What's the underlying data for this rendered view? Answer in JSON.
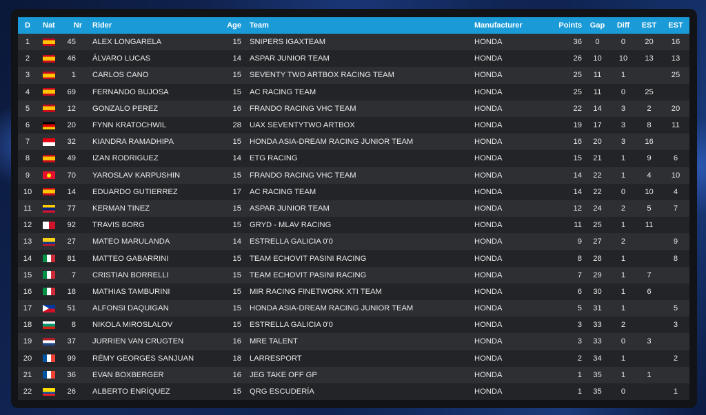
{
  "columns": [
    "D",
    "Nat",
    "Nr",
    "Rider",
    "Age",
    "Team",
    "Manufacturer",
    "Points",
    "Gap",
    "Diff",
    "EST",
    "EST"
  ],
  "rows": [
    {
      "pos": "1",
      "flag": "es",
      "nr": "45",
      "rider": "Alex Longarela",
      "age": "15",
      "team": "Snipers IGAXTeam",
      "manufacturer": "Honda",
      "points": "36",
      "gap": "0",
      "diff": "0",
      "est1": "20",
      "est2": "16"
    },
    {
      "pos": "2",
      "flag": "es",
      "nr": "46",
      "rider": "Álvaro Lucas",
      "age": "14",
      "team": "Aspar Junior Team",
      "manufacturer": "Honda",
      "points": "26",
      "gap": "10",
      "diff": "10",
      "est1": "13",
      "est2": "13"
    },
    {
      "pos": "3",
      "flag": "es",
      "nr": "1",
      "rider": "Carlos Cano",
      "age": "15",
      "team": "Seventy Two Artbox Racing Team",
      "manufacturer": "Honda",
      "points": "25",
      "gap": "11",
      "diff": "1",
      "est1": "",
      "est2": "25"
    },
    {
      "pos": "4",
      "flag": "es",
      "nr": "69",
      "rider": "Fernando Bujosa",
      "age": "15",
      "team": "AC Racing Team",
      "manufacturer": "Honda",
      "points": "25",
      "gap": "11",
      "diff": "0",
      "est1": "25",
      "est2": ""
    },
    {
      "pos": "5",
      "flag": "es",
      "nr": "12",
      "rider": "Gonzalo Perez",
      "age": "16",
      "team": "Frando Racing VHC Team",
      "manufacturer": "Honda",
      "points": "22",
      "gap": "14",
      "diff": "3",
      "est1": "2",
      "est2": "20"
    },
    {
      "pos": "6",
      "flag": "de",
      "nr": "20",
      "rider": "Fynn Kratochwil",
      "age": "28",
      "team": "UAX SeventyTwo Artbox",
      "manufacturer": "Honda",
      "points": "19",
      "gap": "17",
      "diff": "3",
      "est1": "8",
      "est2": "11"
    },
    {
      "pos": "7",
      "flag": "id",
      "nr": "32",
      "rider": "Kiandra Ramadhipa",
      "age": "15",
      "team": "Honda Asia-Dream Racing Junior Team",
      "manufacturer": "Honda",
      "points": "16",
      "gap": "20",
      "diff": "3",
      "est1": "16",
      "est2": ""
    },
    {
      "pos": "8",
      "flag": "es",
      "nr": "49",
      "rider": "Izan Rodriguez",
      "age": "14",
      "team": "ETG Racing",
      "manufacturer": "Honda",
      "points": "15",
      "gap": "21",
      "diff": "1",
      "est1": "9",
      "est2": "6"
    },
    {
      "pos": "9",
      "flag": "kg",
      "nr": "70",
      "rider": "Yaroslav Karpushin",
      "age": "15",
      "team": "Frando Racing VHC Team",
      "manufacturer": "Honda",
      "points": "14",
      "gap": "22",
      "diff": "1",
      "est1": "4",
      "est2": "10"
    },
    {
      "pos": "10",
      "flag": "es",
      "nr": "14",
      "rider": "Eduardo Gutierrez",
      "age": "17",
      "team": "AC Racing Team",
      "manufacturer": "Honda",
      "points": "14",
      "gap": "22",
      "diff": "0",
      "est1": "10",
      "est2": "4"
    },
    {
      "pos": "11",
      "flag": "ve",
      "nr": "77",
      "rider": "Kerman Tinez",
      "age": "15",
      "team": "Aspar Junior Team",
      "manufacturer": "Honda",
      "points": "12",
      "gap": "24",
      "diff": "2",
      "est1": "5",
      "est2": "7"
    },
    {
      "pos": "12",
      "flag": "mt",
      "nr": "92",
      "rider": "Travis Borg",
      "age": "15",
      "team": "GRYD - MLAV Racing",
      "manufacturer": "Honda",
      "points": "11",
      "gap": "25",
      "diff": "1",
      "est1": "11",
      "est2": ""
    },
    {
      "pos": "13",
      "flag": "co",
      "nr": "27",
      "rider": "Mateo Marulanda",
      "age": "14",
      "team": "Estrella Galicia 0'0",
      "manufacturer": "Honda",
      "points": "9",
      "gap": "27",
      "diff": "2",
      "est1": "",
      "est2": "9"
    },
    {
      "pos": "14",
      "flag": "it",
      "nr": "81",
      "rider": "Matteo Gabarrini",
      "age": "15",
      "team": "Team Echovit Pasini Racing",
      "manufacturer": "Honda",
      "points": "8",
      "gap": "28",
      "diff": "1",
      "est1": "",
      "est2": "8"
    },
    {
      "pos": "15",
      "flag": "it",
      "nr": "7",
      "rider": "Cristian Borrelli",
      "age": "15",
      "team": "Team Echovit Pasini Racing",
      "manufacturer": "Honda",
      "points": "7",
      "gap": "29",
      "diff": "1",
      "est1": "7",
      "est2": ""
    },
    {
      "pos": "16",
      "flag": "it",
      "nr": "18",
      "rider": "Mathias Tamburini",
      "age": "15",
      "team": "MIR Racing Finetwork XTI Team",
      "manufacturer": "Honda",
      "points": "6",
      "gap": "30",
      "diff": "1",
      "est1": "6",
      "est2": ""
    },
    {
      "pos": "17",
      "flag": "ph",
      "nr": "51",
      "rider": "Alfonsi Daquigan",
      "age": "15",
      "team": "Honda Asia-Dream Racing Junior Team",
      "manufacturer": "Honda",
      "points": "5",
      "gap": "31",
      "diff": "1",
      "est1": "",
      "est2": "5"
    },
    {
      "pos": "18",
      "flag": "bg",
      "nr": "8",
      "rider": "Nikola Miroslalov",
      "age": "15",
      "team": "Estrella Galicia 0'0",
      "manufacturer": "Honda",
      "points": "3",
      "gap": "33",
      "diff": "2",
      "est1": "",
      "est2": "3"
    },
    {
      "pos": "19",
      "flag": "nl",
      "nr": "37",
      "rider": "Jurrien van Crugten",
      "age": "16",
      "team": "MRE Talent",
      "manufacturer": "Honda",
      "points": "3",
      "gap": "33",
      "diff": "0",
      "est1": "3",
      "est2": ""
    },
    {
      "pos": "20",
      "flag": "fr",
      "nr": "99",
      "rider": "Rémy Georges Sanjuan",
      "age": "18",
      "team": "Larresport",
      "manufacturer": "Honda",
      "points": "2",
      "gap": "34",
      "diff": "1",
      "est1": "",
      "est2": "2"
    },
    {
      "pos": "21",
      "flag": "fr",
      "nr": "36",
      "rider": "Evan Boxberger",
      "age": "16",
      "team": "JEG Take Off GP",
      "manufacturer": "Honda",
      "points": "1",
      "gap": "35",
      "diff": "1",
      "est1": "1",
      "est2": ""
    },
    {
      "pos": "22",
      "flag": "ec",
      "nr": "26",
      "rider": "Alberto Enríquez",
      "age": "15",
      "team": "QRG Escudería",
      "manufacturer": "Honda",
      "points": "1",
      "gap": "35",
      "diff": "0",
      "est1": "",
      "est2": "1"
    }
  ]
}
